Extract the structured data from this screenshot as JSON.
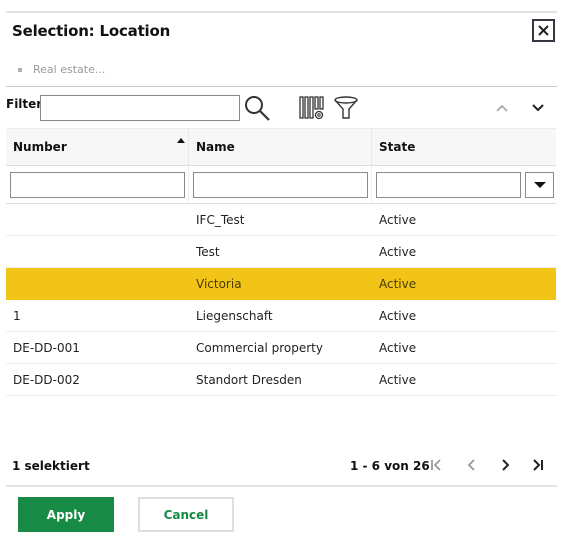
{
  "dialog": {
    "title": "Selection: Location",
    "close_icon": "close-icon",
    "breadcrumb": "Real estate..."
  },
  "toolbar": {
    "filter_label": "Filter",
    "filter_value": "",
    "filter_placeholder": "",
    "icons": [
      "search-icon",
      "column-settings-icon",
      "filter-funnel-icon",
      "chevron-up-icon",
      "chevron-down-icon"
    ]
  },
  "grid": {
    "columns": [
      {
        "label": "Number",
        "sort": "ascending"
      },
      {
        "label": "Name"
      },
      {
        "label": "State"
      }
    ],
    "column_filters": {
      "number": "",
      "name": "",
      "state": ""
    },
    "rows": [
      {
        "number": "",
        "name": "IFC_Test",
        "state": "Active",
        "selected": false
      },
      {
        "number": "",
        "name": "Test",
        "state": "Active",
        "selected": false
      },
      {
        "number": "",
        "name": "Victoria",
        "state": "Active",
        "selected": true
      },
      {
        "number": "1",
        "name": "Liegenschaft",
        "state": "Active",
        "selected": false
      },
      {
        "number": "DE-DD-001",
        "name": "Commercial property",
        "state": "Active",
        "selected": false
      },
      {
        "number": "DE-DD-002",
        "name": "Standort Dresden",
        "state": "Active",
        "selected": false
      }
    ],
    "selection_color": "#f1c417"
  },
  "footer": {
    "selected_count": "1 selektiert",
    "pager_info": "1 - 6 von 26",
    "pager_icons": [
      "first-page-icon",
      "previous-page-icon",
      "next-page-icon",
      "last-page-icon"
    ]
  },
  "actions": {
    "apply_label": "Apply",
    "cancel_label": "Cancel",
    "accent_color": "#178a45"
  }
}
